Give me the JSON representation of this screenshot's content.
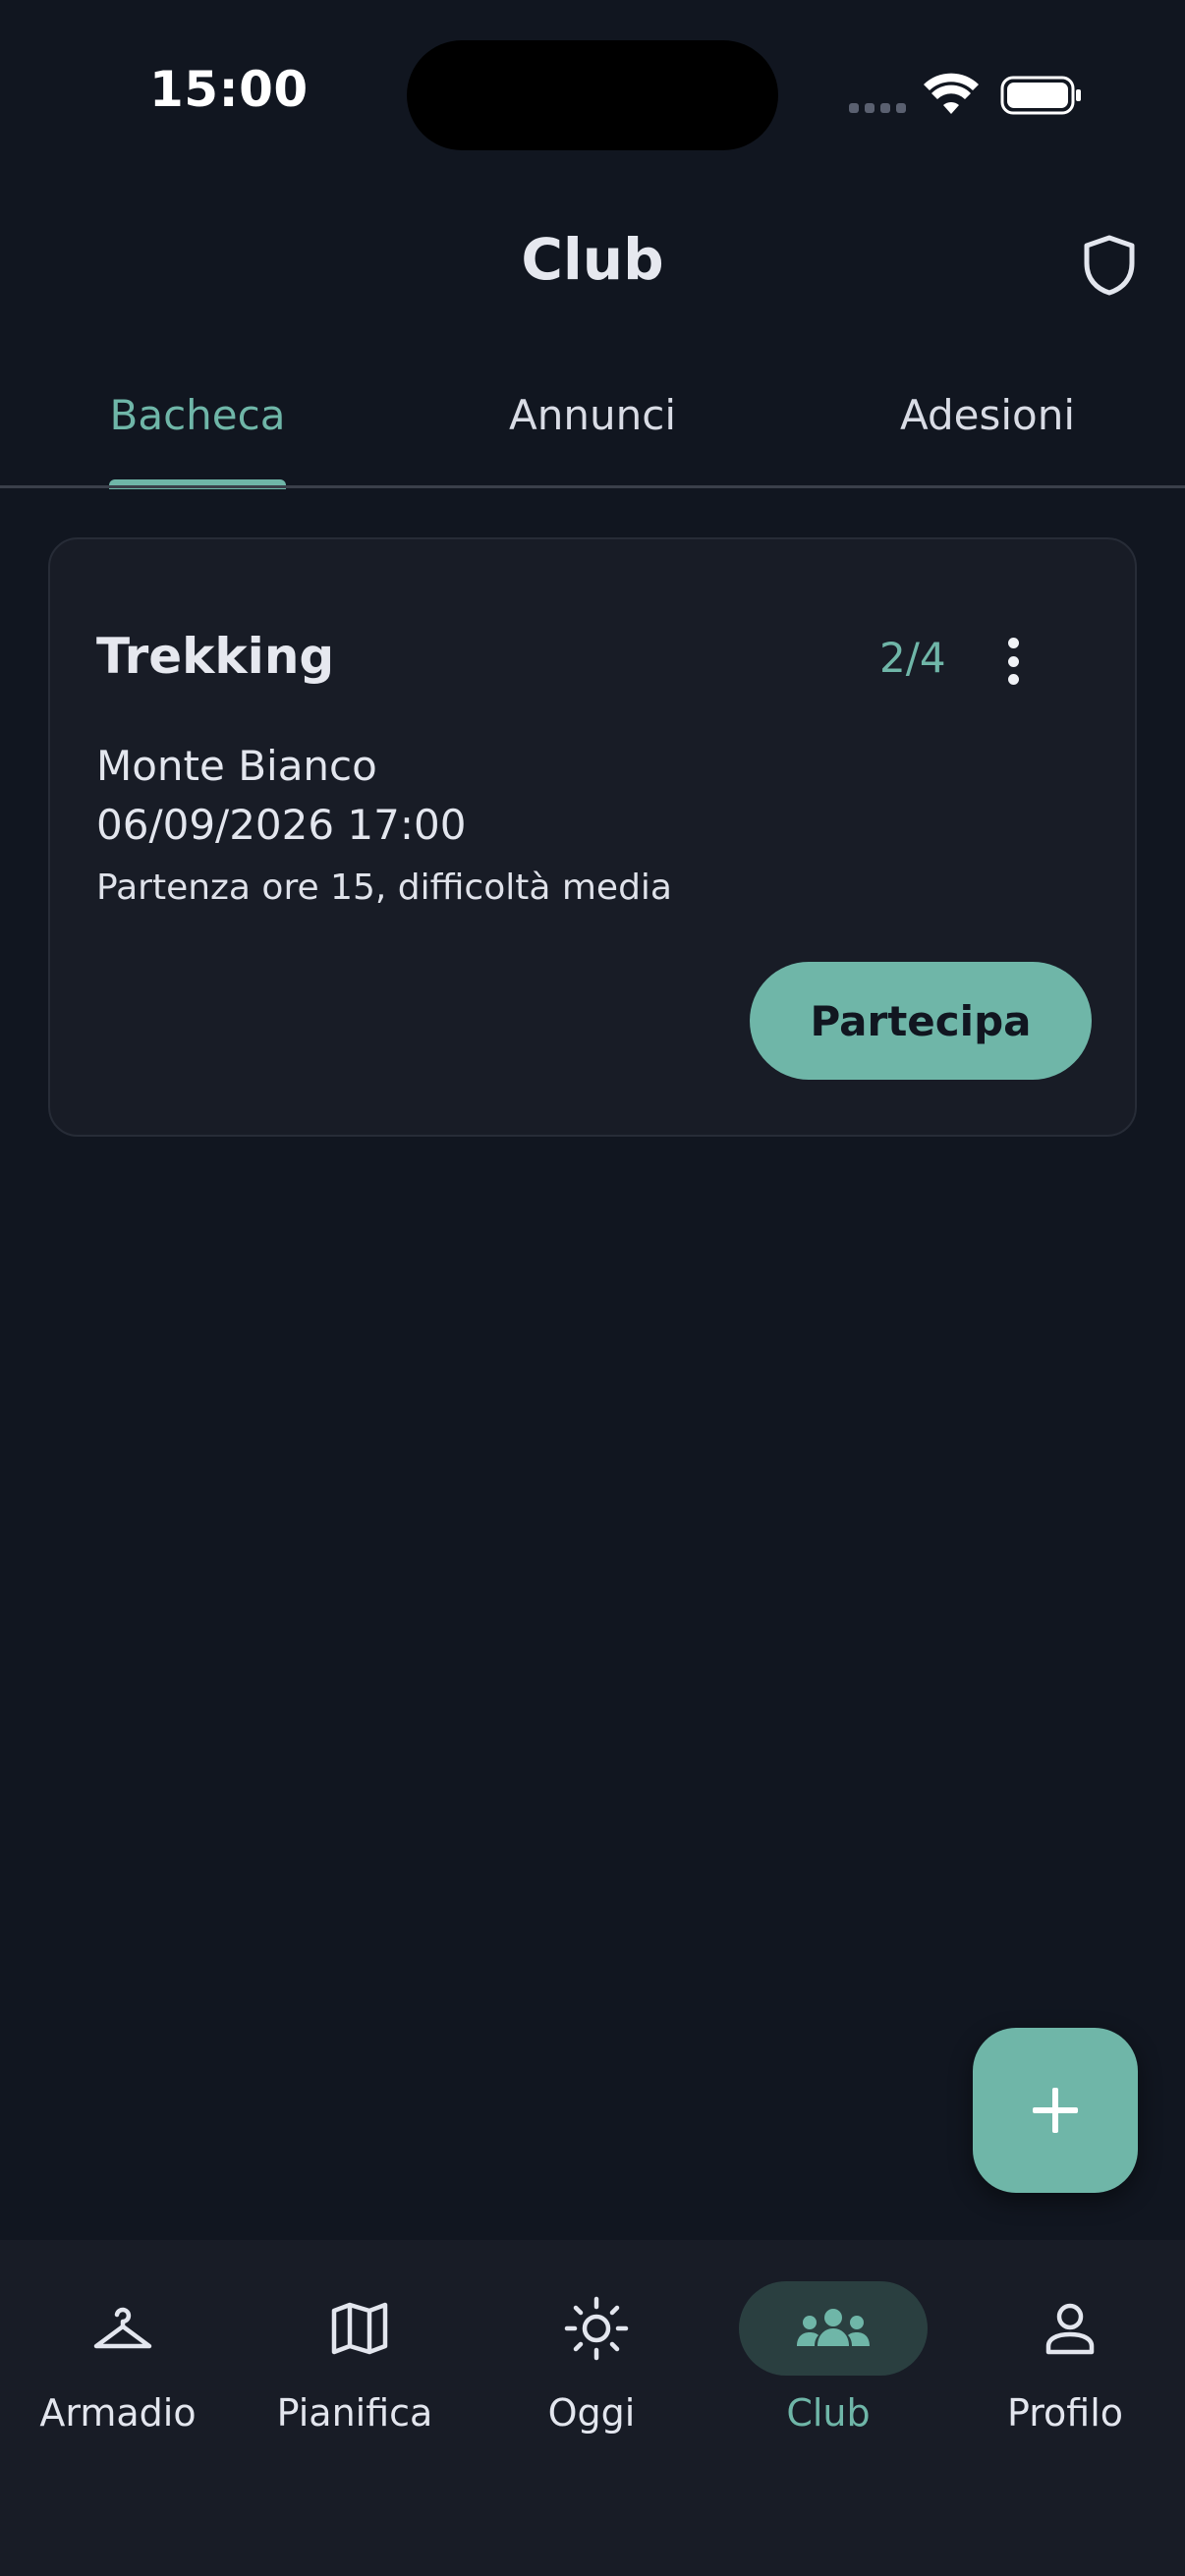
{
  "status_bar": {
    "time": "15:00"
  },
  "header": {
    "title": "Club"
  },
  "tabs": [
    {
      "label": "Bacheca",
      "active": true
    },
    {
      "label": "Annunci",
      "active": false
    },
    {
      "label": "Adesioni",
      "active": false
    }
  ],
  "card": {
    "title": "Trekking",
    "count": "2/4",
    "place": "Monte Bianco",
    "datetime": "06/09/2026 17:00",
    "description": "Partenza ore 15, difficoltà media",
    "action_label": "Partecipa"
  },
  "nav": [
    {
      "label": "Armadio",
      "icon": "hanger-icon"
    },
    {
      "label": "Pianifica",
      "icon": "map-icon"
    },
    {
      "label": "Oggi",
      "icon": "sun-icon"
    },
    {
      "label": "Club",
      "icon": "group-icon",
      "active": true
    },
    {
      "label": "Profilo",
      "icon": "person-icon"
    }
  ],
  "colors": {
    "background": "#111620",
    "surface": "#181c26",
    "accent": "#6fb6a8",
    "active_pill": "#2a3f40"
  }
}
